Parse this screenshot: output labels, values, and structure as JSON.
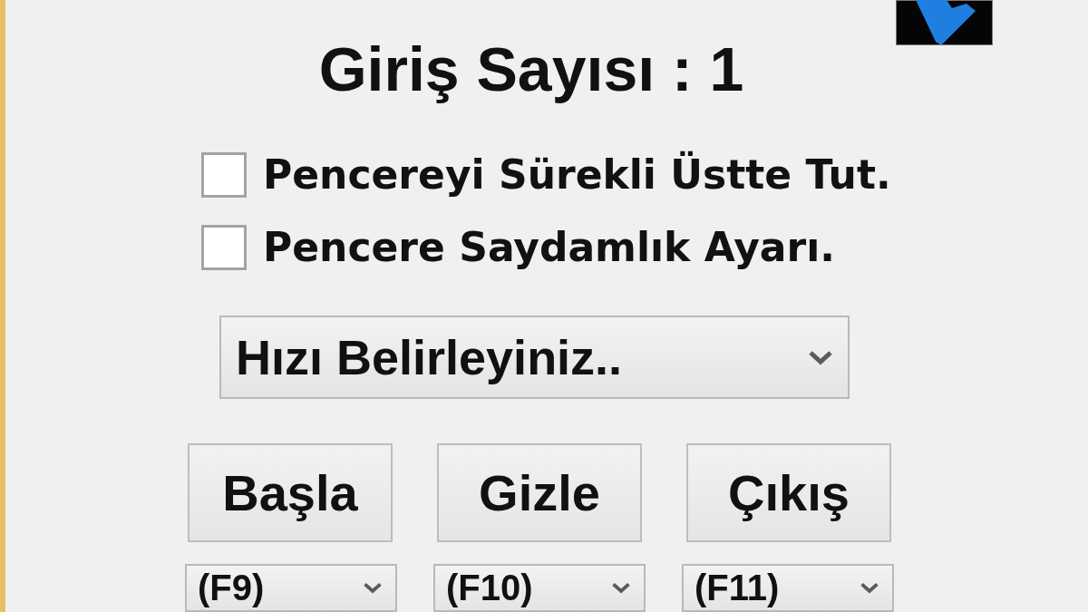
{
  "title": "Giriş Sayısı : 1",
  "options": [
    {
      "label": "Pencereyi Sürekli Üstte Tut.",
      "checked": false
    },
    {
      "label": "Pencere Saydamlık Ayarı.",
      "checked": false
    }
  ],
  "speed_select": {
    "value": "Hızı Belirleyiniz.."
  },
  "buttons": [
    "Başla",
    "Gizle",
    "Çıkış"
  ],
  "hotkey_selects": [
    {
      "value": "(F9)"
    },
    {
      "value": "(F10)"
    },
    {
      "value": "(F11)"
    }
  ]
}
